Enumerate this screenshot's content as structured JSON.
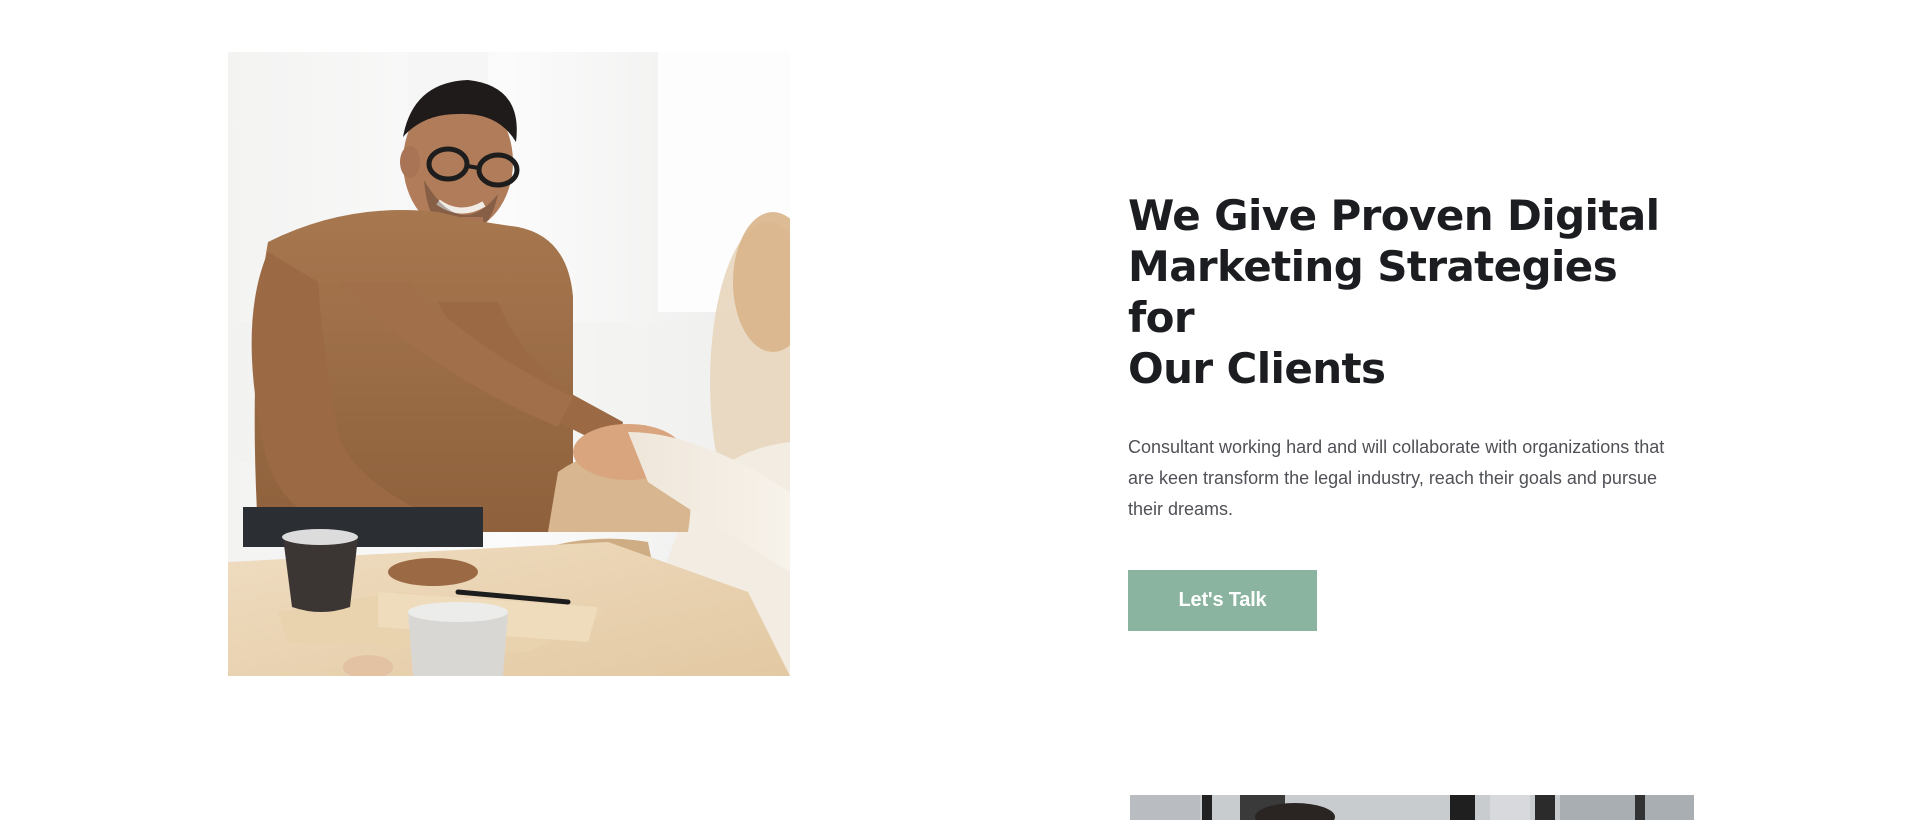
{
  "about": {
    "headline_line1": "We Give Proven Digital",
    "headline_line2": "Marketing Strategies for",
    "headline_line3": "Our Clients",
    "body": "Consultant working hard and will collaborate with organizations that are keen transform the legal industry, reach their goals and pursue their dreams.",
    "cta_label": "Let's Talk"
  },
  "colors": {
    "accent": "#8ab4a0",
    "heading": "#1c1d21",
    "body": "#4f5156",
    "background": "#ffffff"
  },
  "images": {
    "hero": "handshake-photo",
    "next_section": "office-photo"
  }
}
